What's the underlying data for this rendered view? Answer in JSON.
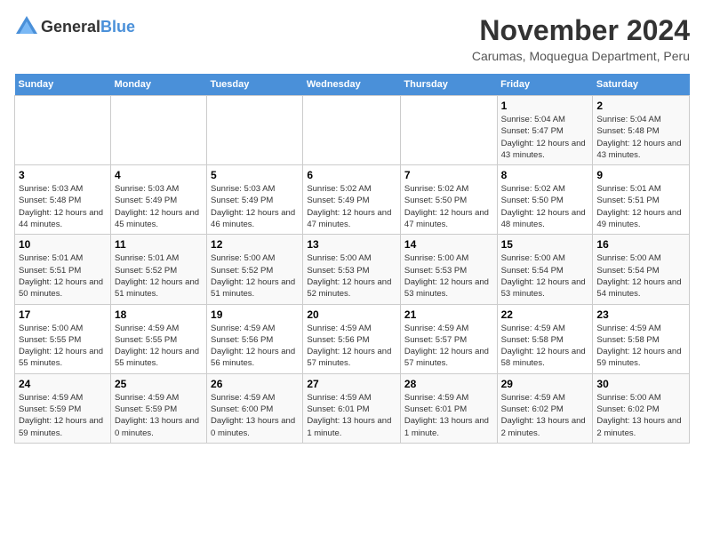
{
  "header": {
    "logo_general": "General",
    "logo_blue": "Blue",
    "title": "November 2024",
    "subtitle": "Carumas, Moquegua Department, Peru"
  },
  "columns": [
    "Sunday",
    "Monday",
    "Tuesday",
    "Wednesday",
    "Thursday",
    "Friday",
    "Saturday"
  ],
  "weeks": [
    [
      {
        "day": "",
        "info": ""
      },
      {
        "day": "",
        "info": ""
      },
      {
        "day": "",
        "info": ""
      },
      {
        "day": "",
        "info": ""
      },
      {
        "day": "",
        "info": ""
      },
      {
        "day": "1",
        "info": "Sunrise: 5:04 AM\nSunset: 5:47 PM\nDaylight: 12 hours and 43 minutes."
      },
      {
        "day": "2",
        "info": "Sunrise: 5:04 AM\nSunset: 5:48 PM\nDaylight: 12 hours and 43 minutes."
      }
    ],
    [
      {
        "day": "3",
        "info": "Sunrise: 5:03 AM\nSunset: 5:48 PM\nDaylight: 12 hours and 44 minutes."
      },
      {
        "day": "4",
        "info": "Sunrise: 5:03 AM\nSunset: 5:49 PM\nDaylight: 12 hours and 45 minutes."
      },
      {
        "day": "5",
        "info": "Sunrise: 5:03 AM\nSunset: 5:49 PM\nDaylight: 12 hours and 46 minutes."
      },
      {
        "day": "6",
        "info": "Sunrise: 5:02 AM\nSunset: 5:49 PM\nDaylight: 12 hours and 47 minutes."
      },
      {
        "day": "7",
        "info": "Sunrise: 5:02 AM\nSunset: 5:50 PM\nDaylight: 12 hours and 47 minutes."
      },
      {
        "day": "8",
        "info": "Sunrise: 5:02 AM\nSunset: 5:50 PM\nDaylight: 12 hours and 48 minutes."
      },
      {
        "day": "9",
        "info": "Sunrise: 5:01 AM\nSunset: 5:51 PM\nDaylight: 12 hours and 49 minutes."
      }
    ],
    [
      {
        "day": "10",
        "info": "Sunrise: 5:01 AM\nSunset: 5:51 PM\nDaylight: 12 hours and 50 minutes."
      },
      {
        "day": "11",
        "info": "Sunrise: 5:01 AM\nSunset: 5:52 PM\nDaylight: 12 hours and 51 minutes."
      },
      {
        "day": "12",
        "info": "Sunrise: 5:00 AM\nSunset: 5:52 PM\nDaylight: 12 hours and 51 minutes."
      },
      {
        "day": "13",
        "info": "Sunrise: 5:00 AM\nSunset: 5:53 PM\nDaylight: 12 hours and 52 minutes."
      },
      {
        "day": "14",
        "info": "Sunrise: 5:00 AM\nSunset: 5:53 PM\nDaylight: 12 hours and 53 minutes."
      },
      {
        "day": "15",
        "info": "Sunrise: 5:00 AM\nSunset: 5:54 PM\nDaylight: 12 hours and 53 minutes."
      },
      {
        "day": "16",
        "info": "Sunrise: 5:00 AM\nSunset: 5:54 PM\nDaylight: 12 hours and 54 minutes."
      }
    ],
    [
      {
        "day": "17",
        "info": "Sunrise: 5:00 AM\nSunset: 5:55 PM\nDaylight: 12 hours and 55 minutes."
      },
      {
        "day": "18",
        "info": "Sunrise: 4:59 AM\nSunset: 5:55 PM\nDaylight: 12 hours and 55 minutes."
      },
      {
        "day": "19",
        "info": "Sunrise: 4:59 AM\nSunset: 5:56 PM\nDaylight: 12 hours and 56 minutes."
      },
      {
        "day": "20",
        "info": "Sunrise: 4:59 AM\nSunset: 5:56 PM\nDaylight: 12 hours and 57 minutes."
      },
      {
        "day": "21",
        "info": "Sunrise: 4:59 AM\nSunset: 5:57 PM\nDaylight: 12 hours and 57 minutes."
      },
      {
        "day": "22",
        "info": "Sunrise: 4:59 AM\nSunset: 5:58 PM\nDaylight: 12 hours and 58 minutes."
      },
      {
        "day": "23",
        "info": "Sunrise: 4:59 AM\nSunset: 5:58 PM\nDaylight: 12 hours and 59 minutes."
      }
    ],
    [
      {
        "day": "24",
        "info": "Sunrise: 4:59 AM\nSunset: 5:59 PM\nDaylight: 12 hours and 59 minutes."
      },
      {
        "day": "25",
        "info": "Sunrise: 4:59 AM\nSunset: 5:59 PM\nDaylight: 13 hours and 0 minutes."
      },
      {
        "day": "26",
        "info": "Sunrise: 4:59 AM\nSunset: 6:00 PM\nDaylight: 13 hours and 0 minutes."
      },
      {
        "day": "27",
        "info": "Sunrise: 4:59 AM\nSunset: 6:01 PM\nDaylight: 13 hours and 1 minute."
      },
      {
        "day": "28",
        "info": "Sunrise: 4:59 AM\nSunset: 6:01 PM\nDaylight: 13 hours and 1 minute."
      },
      {
        "day": "29",
        "info": "Sunrise: 4:59 AM\nSunset: 6:02 PM\nDaylight: 13 hours and 2 minutes."
      },
      {
        "day": "30",
        "info": "Sunrise: 5:00 AM\nSunset: 6:02 PM\nDaylight: 13 hours and 2 minutes."
      }
    ]
  ]
}
